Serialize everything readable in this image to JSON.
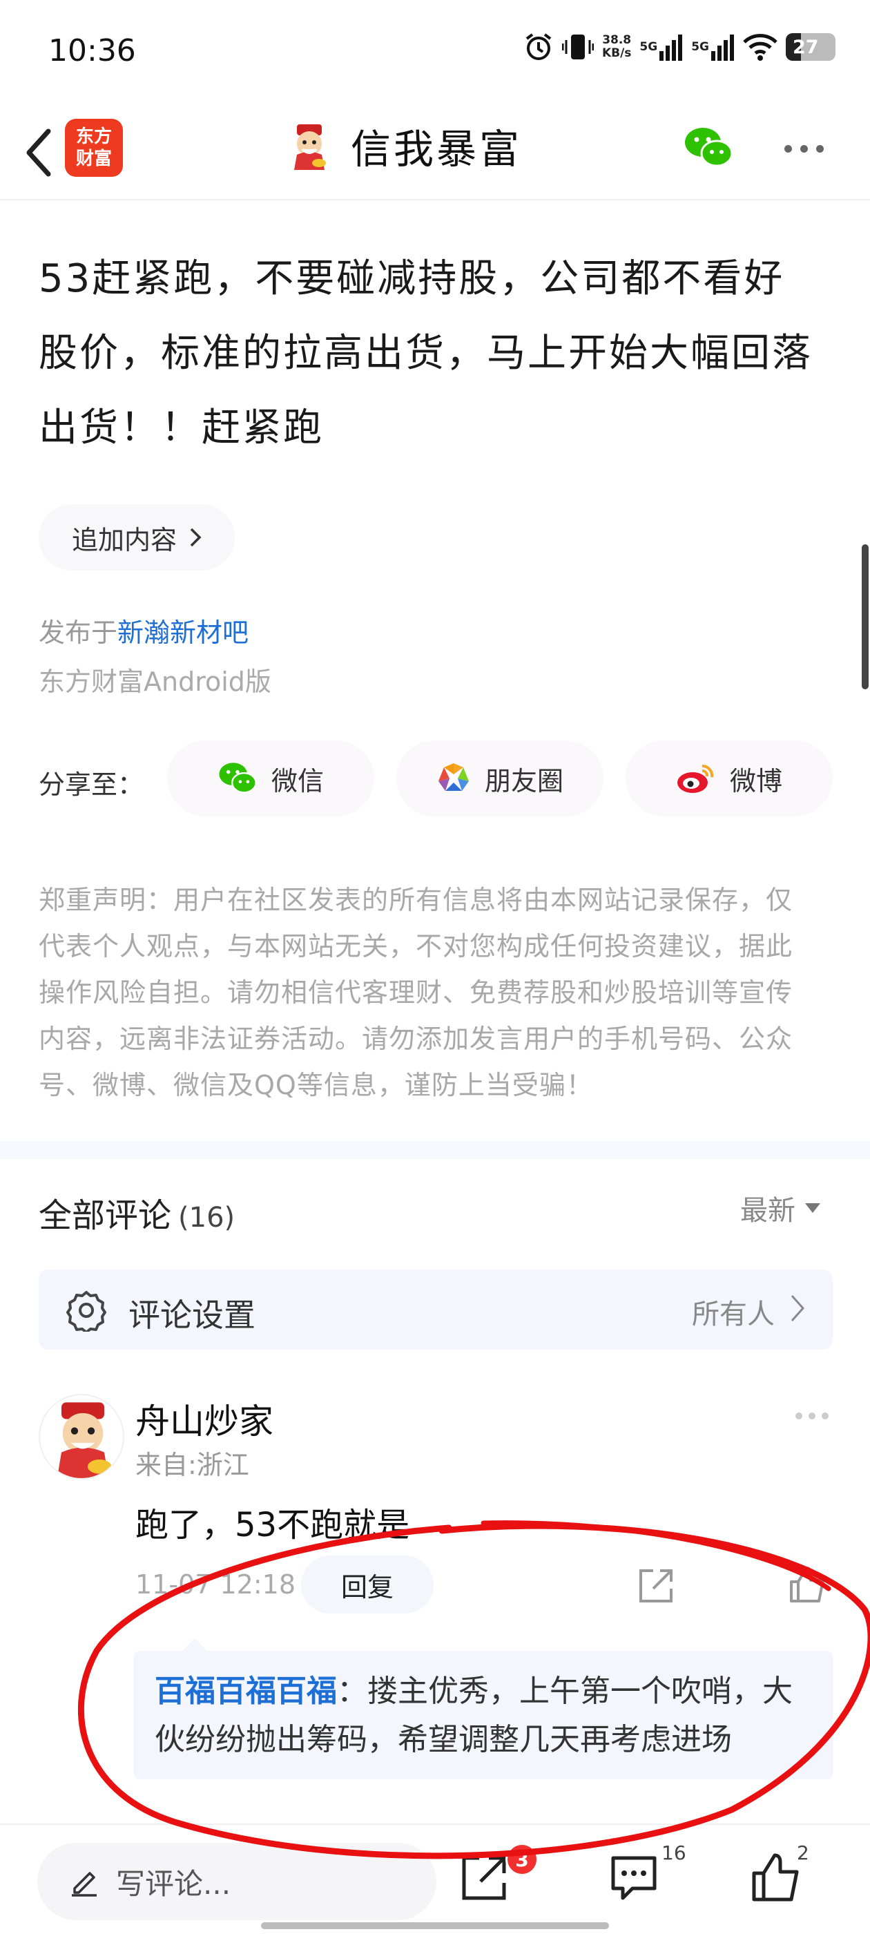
{
  "status_bar": {
    "time": "10:36",
    "net_speed_value": "38.8",
    "net_speed_unit": "KB/s",
    "sim1": "5G",
    "sim2": "5G",
    "battery": "27"
  },
  "nav": {
    "logo_line1": "东方",
    "logo_line2": "财富",
    "title": "信我暴富"
  },
  "post": {
    "lines": [
      "53赶紧跑，不要碰减持股，公司都不看好",
      "股价，标准的拉高出货，马上开始大幅回落",
      "出货！！赶紧跑"
    ],
    "append_label": "追加内容",
    "published_prefix": "发布于",
    "published_forum": "新瀚新材吧",
    "source": "东方财富Android版"
  },
  "share": {
    "label": "分享至：",
    "items": [
      {
        "label": "微信",
        "icon": "wechat-icon"
      },
      {
        "label": "朋友圈",
        "icon": "moments-icon"
      },
      {
        "label": "微博",
        "icon": "weibo-icon"
      }
    ]
  },
  "disclaimer": [
    "郑重声明：用户在社区发表的所有信息将由本网站记录保存，仅",
    "代表个人观点，与本网站无关，不对您构成任何投资建议，据此",
    "操作风险自担。请勿相信代客理财、免费荐股和炒股培训等宣传",
    "内容，远离非法证券活动。请勿添加发言用户的手机号码、公众",
    "号、微博、微信及QQ等信息，谨防上当受骗！"
  ],
  "comments": {
    "title": "全部评论",
    "count": "(16)",
    "sort": "最新",
    "settings_label": "评论设置",
    "settings_value": "所有人",
    "items": [
      {
        "user": "舟山炒家",
        "location": "来自:浙江",
        "text": "跑了，53不跑就是",
        "time": "11-07 12:18",
        "reply_label": "回复",
        "reply": {
          "user": "百福百福百福",
          "text_line1": "：搂主优秀，上午第一个吹哨，大",
          "text_line2": "伙纷纷抛出筹码，希望调整几天再考虑进场"
        }
      }
    ]
  },
  "bottom_bar": {
    "write_placeholder": "写评论...",
    "share_badge": "3",
    "comment_count": "16",
    "like_count": "2"
  },
  "colors": {
    "accent_blue": "#1d6fd6",
    "logo_red": "#ee3b1f",
    "badge_red": "#f23030",
    "annotation_red": "#e81010"
  }
}
